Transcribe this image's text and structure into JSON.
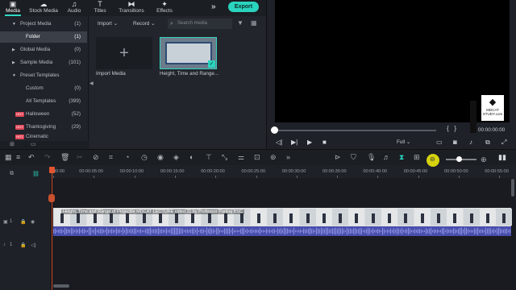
{
  "tabs": [
    {
      "label": "Media",
      "icon": "media-icon"
    },
    {
      "label": "Stock Media",
      "icon": "cloud-icon"
    },
    {
      "label": "Audio",
      "icon": "music-icon"
    },
    {
      "label": "Titles",
      "icon": "text-icon"
    },
    {
      "label": "Transitions",
      "icon": "transition-icon"
    },
    {
      "label": "Effects",
      "icon": "effects-icon"
    }
  ],
  "export_label": "Export",
  "sidebar": [
    {
      "label": "Project Media",
      "count": "(1)"
    },
    {
      "label": "Folder",
      "count": "(1)"
    },
    {
      "label": "Global Media",
      "count": "(0)"
    },
    {
      "label": "Sample Media",
      "count": "(101)"
    },
    {
      "label": "Preset Templates",
      "count": ""
    },
    {
      "label": "Custom",
      "count": "(0)"
    },
    {
      "label": "All Templates",
      "count": "(399)"
    },
    {
      "label": "Halloween",
      "count": "(52)"
    },
    {
      "label": "Thanksgiving",
      "count": "(29)"
    },
    {
      "label": "Cinematic",
      "count": ""
    }
  ],
  "hot_badge": "HOT",
  "media": {
    "import_dropdown": "Import",
    "record_dropdown": "Record",
    "search_placeholder": "Search media",
    "import_label": "Import Media",
    "clip_label": "Height, Time and Range..."
  },
  "preview": {
    "time": "00:00:00:00",
    "quality": "Full",
    "logo_line1": "MDCAT",
    "logo_line2": "STUDY.com"
  },
  "ruler_ticks": [
    "00:00",
    "00:00:05:00",
    "00:00:10:00",
    "00:00:15:00",
    "00:00:20:00",
    "00:00:25:00",
    "00:00:30:00",
    "00:00:35:00",
    "00:00:40:00",
    "00:00:45:00",
    "00:00:50:00",
    "00:00:55:00"
  ],
  "track": {
    "video_label": "1",
    "audio_label": "1",
    "clip_title": "Height, Time and Range of Projectile MDCAT LECTURE video 11 by Professor Pankaj BSC"
  }
}
